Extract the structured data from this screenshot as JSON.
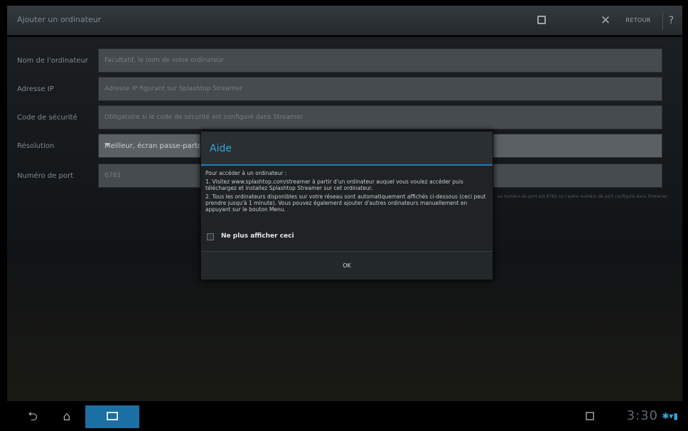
{
  "actionbar": {
    "title": "Ajouter un ordinateur",
    "save_icon": "save-icon",
    "cancel_glyph": "✕",
    "back_label": "RETOUR",
    "help_glyph": "?"
  },
  "form": {
    "computer_name": {
      "label": "Nom de l'ordinateur",
      "placeholder": "Facultatif, le nom de votre ordinateur"
    },
    "ip_address": {
      "label": "Adresse IP",
      "placeholder": "Adresse IP figurant sur Splashtop Streamer"
    },
    "security_code": {
      "label": "Code de sécurité",
      "placeholder": "Obligatoire si le code de sécurité est configuré dans Streamer"
    },
    "resolution": {
      "label": "Résolution",
      "value": "Meilleur, écran passe-partout"
    },
    "port": {
      "label": "Numéro de port",
      "value": "6783"
    },
    "port_note": "Le numéro de port est 6783 ou l'autre numéro de port configuré dans Streamer"
  },
  "dialog": {
    "title": "Aide",
    "intro": "Pour accéder à un ordinateur :",
    "step1": "1. Visitez www.splashtop.com/streamer à partir d'un ordinateur auquel vous voulez accéder puis téléchargez et installez Splashtop Streamer sur cet ordinateur.",
    "step2": "2. Tous les ordinateurs disponibles sur votre réseau sont automatiquement affichés ci-dessous (ceci peut prendre jusqu'à 1 minute). Vous pouvez également ajouter d'autres ordinateurs manuellement en appuyant sur le bouton Menu.",
    "checkbox_label": "Ne plus afficher ceci",
    "checkbox_checked": false,
    "ok_label": "OK",
    "accent_color": "#33a6df"
  },
  "sysbar": {
    "time": "3:30",
    "status_icons": "✱▾▮"
  }
}
